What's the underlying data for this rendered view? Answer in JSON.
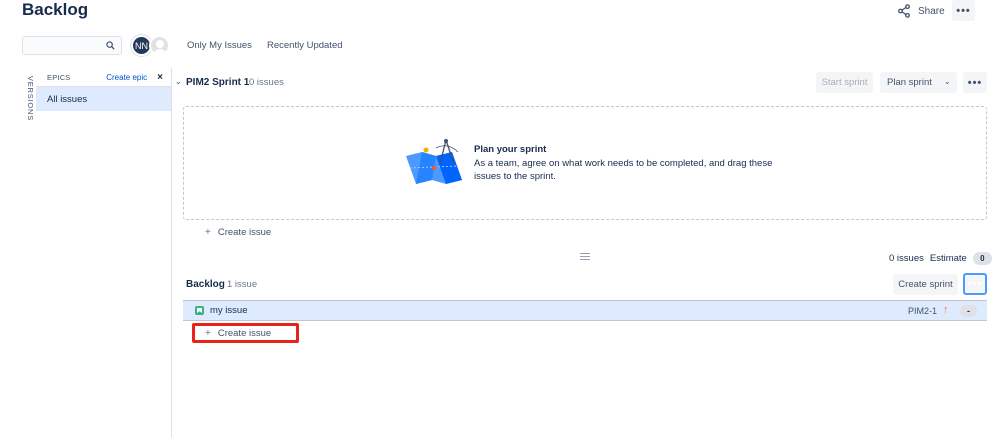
{
  "header": {
    "title": "Backlog",
    "share_label": "Share",
    "more_icon": "more-horizontal-icon"
  },
  "filters": {
    "search_placeholder": "",
    "avatar_initials": "NN",
    "only_my_issues": "Only My Issues",
    "recently_updated": "Recently Updated"
  },
  "sidebar": {
    "versions_label": "VERSIONS",
    "epics_label": "EPICS",
    "create_epic": "Create epic",
    "close_icon": "×",
    "all_issues": "All issues"
  },
  "sprint": {
    "name": "PIM2 Sprint 1",
    "issue_count": "0 issues",
    "start_sprint": "Start sprint",
    "plan_sprint": "Plan sprint",
    "empty_title": "Plan your sprint",
    "empty_description": "As a team, agree on what work needs to be completed, and drag these issues to the sprint.",
    "create_issue": "Create issue",
    "summary_issues": "0 issues",
    "summary_estimate_label": "Estimate",
    "summary_estimate_value": "0"
  },
  "backlog": {
    "name": "Backlog",
    "issue_count": "1 issue",
    "create_sprint": "Create sprint",
    "issues": [
      {
        "summary": "my issue",
        "key": "PIM2-1",
        "priority": "↑",
        "estimate": "-",
        "type": "story"
      }
    ],
    "create_issue": "Create issue"
  },
  "colors": {
    "selected_bg": "#deebff",
    "link": "#0052cc",
    "highlight": "#e8231c",
    "story": "#36b37e",
    "priority_high": "#ff7452"
  }
}
